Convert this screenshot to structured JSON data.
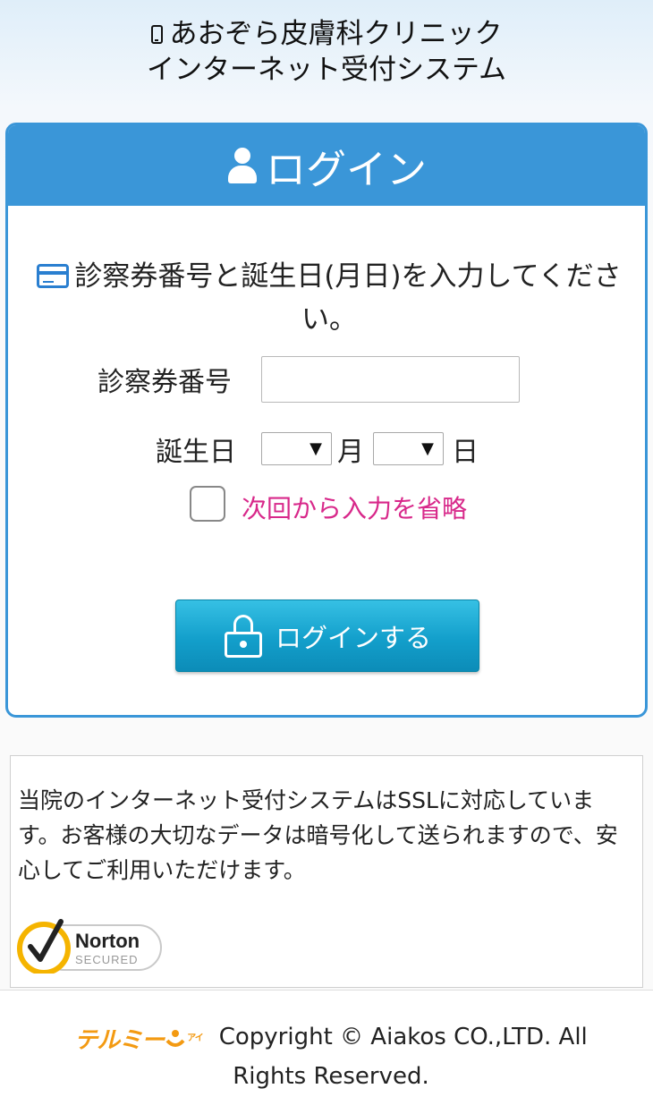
{
  "header": {
    "line1": "あおぞら皮膚科クリニック",
    "line2": "インターネット受付システム"
  },
  "login": {
    "title": "ログイン",
    "instruction": "診察券番号と誕生日(月日)を入力してください。",
    "card_number_label": "診察券番号",
    "card_number_value": "",
    "birthday_label": "誕生日",
    "month_value": "",
    "month_unit": "月",
    "day_value": "",
    "day_unit": "日",
    "remember_label": "次回から入力を省略",
    "remember_checked": false,
    "submit_label": "ログインする"
  },
  "ssl": {
    "text": "当院のインターネット受付システムはSSLに対応しています。お客様の大切なデータは暗号化して送られますので、安心してご利用いただけます。",
    "badge_name": "Norton",
    "badge_sub": "SECURED"
  },
  "footer": {
    "logo_text": "テルミー",
    "logo_sub": "アイ",
    "copyright": "Copyright © Aiakos CO.,LTD. All Rights Reserved."
  },
  "colors": {
    "primary": "#3a96d8",
    "button": "#139fcb",
    "accent_pink": "#d8288a",
    "logo_orange": "#f39a12"
  }
}
